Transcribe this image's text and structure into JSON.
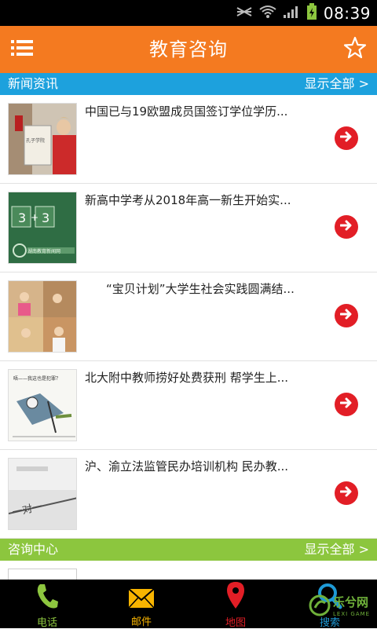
{
  "status_bar": {
    "time": "08:39"
  },
  "header": {
    "title": "教育咨询"
  },
  "sections": {
    "news": {
      "title": "新闻资讯",
      "more": "显示全部 >"
    },
    "consult": {
      "title": "咨询中心",
      "more": "显示全部 >"
    }
  },
  "news_items": [
    {
      "title": "中国已与19欧盟成员国签订学位学历...",
      "thumb_text": "孔子学院"
    },
    {
      "title": "新高中学考从2018年高一新生开始实...",
      "thumb_text": "湖南教育新闻网"
    },
    {
      "title": "“宝贝计划”大学生社会实践圆满结...",
      "thumb_text": ""
    },
    {
      "title": "北大附中教师捞好处费获刑 帮学生上...",
      "thumb_text": "唔——我这也是犯罪？"
    },
    {
      "title": "沪、渝立法监管民办培训机构 民办教...",
      "thumb_text": "一对一"
    }
  ],
  "bottom_nav": [
    {
      "label": "电话",
      "icon": "phone-icon",
      "color": "#8dc63f"
    },
    {
      "label": "邮件",
      "icon": "mail-icon",
      "color": "#f8b400"
    },
    {
      "label": "地图",
      "icon": "map-pin-icon",
      "color": "#e21e26"
    },
    {
      "label": "搜索",
      "icon": "search-icon",
      "color": "#1e9ad6"
    }
  ],
  "watermark": {
    "text": "乐兮网",
    "sub": "LEXI GAME"
  },
  "colors": {
    "app_bar": "#f47a20",
    "news_section": "#1da1dd",
    "consult_section": "#8cc63e",
    "arrow": "#e21e26",
    "nav_bg": "#000000"
  }
}
